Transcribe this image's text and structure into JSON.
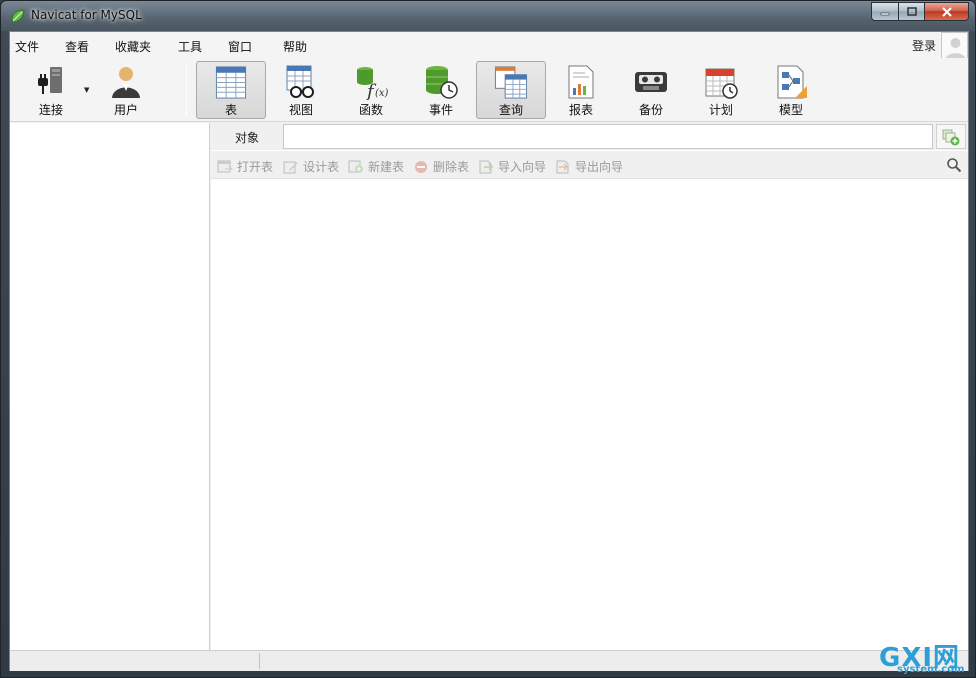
{
  "window": {
    "title": "Navicat for MySQL"
  },
  "menu": {
    "items": [
      "文件",
      "查看",
      "收藏夹",
      "工具",
      "窗口",
      "帮助"
    ],
    "login": "登录"
  },
  "toolbar": {
    "items": [
      {
        "label": "连接",
        "icon": "connection-icon"
      },
      {
        "label": "用户",
        "icon": "user-icon"
      },
      {
        "label": "表",
        "icon": "table-icon",
        "active": true
      },
      {
        "label": "视图",
        "icon": "view-icon"
      },
      {
        "label": "函数",
        "icon": "function-icon"
      },
      {
        "label": "事件",
        "icon": "event-icon"
      },
      {
        "label": "查询",
        "icon": "query-icon"
      },
      {
        "label": "报表",
        "icon": "report-icon"
      },
      {
        "label": "备份",
        "icon": "backup-icon"
      },
      {
        "label": "计划",
        "icon": "schedule-icon"
      },
      {
        "label": "模型",
        "icon": "model-icon"
      }
    ]
  },
  "objects": {
    "tab_label": "对象",
    "actions": [
      "打开表",
      "设计表",
      "新建表",
      "删除表",
      "导入向导",
      "导出向导"
    ]
  },
  "watermark": {
    "main": "GXI网",
    "sub": "system.com"
  },
  "colors": {
    "accent": "#2d9fd6",
    "disabled_text": "#9a9a9a"
  }
}
